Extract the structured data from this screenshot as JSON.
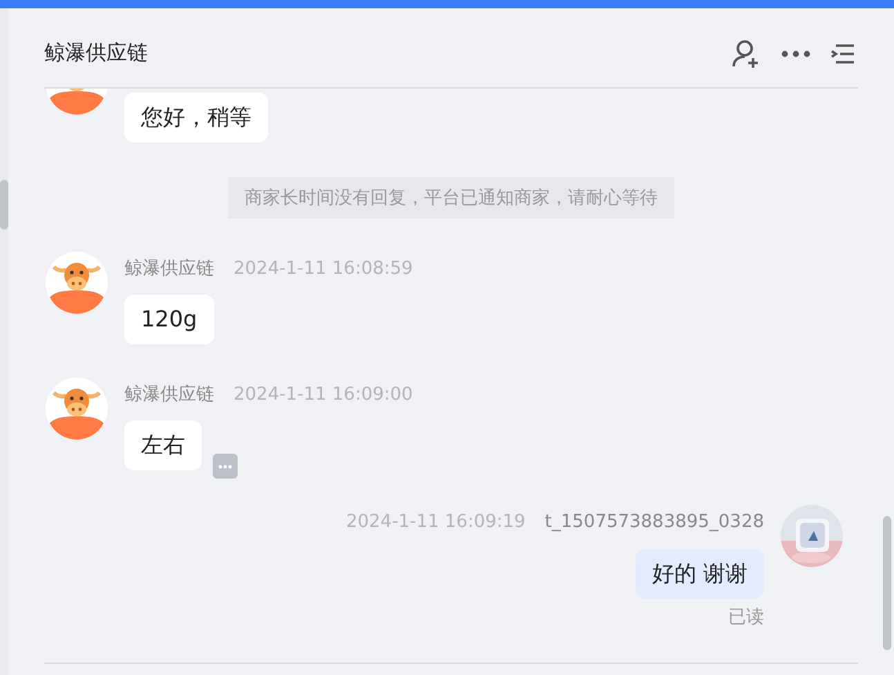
{
  "header": {
    "title": "鲸瀑供应链"
  },
  "messages": [
    {
      "kind": "incoming",
      "text": "您好，稍等"
    },
    {
      "kind": "system",
      "text": "商家长时间没有回复，平台已通知商家，请耐心等待"
    },
    {
      "kind": "incoming",
      "sender": "鲸瀑供应链",
      "time": "2024-1-11 16:08:59",
      "text": "120g"
    },
    {
      "kind": "incoming",
      "sender": "鲸瀑供应链",
      "time": "2024-1-11 16:09:00",
      "text": "左右",
      "more": true
    },
    {
      "kind": "outgoing",
      "sender": "t_1507573883895_0328",
      "time": "2024-1-11 16:09:19",
      "text": "好的 谢谢",
      "status": "已读"
    }
  ]
}
